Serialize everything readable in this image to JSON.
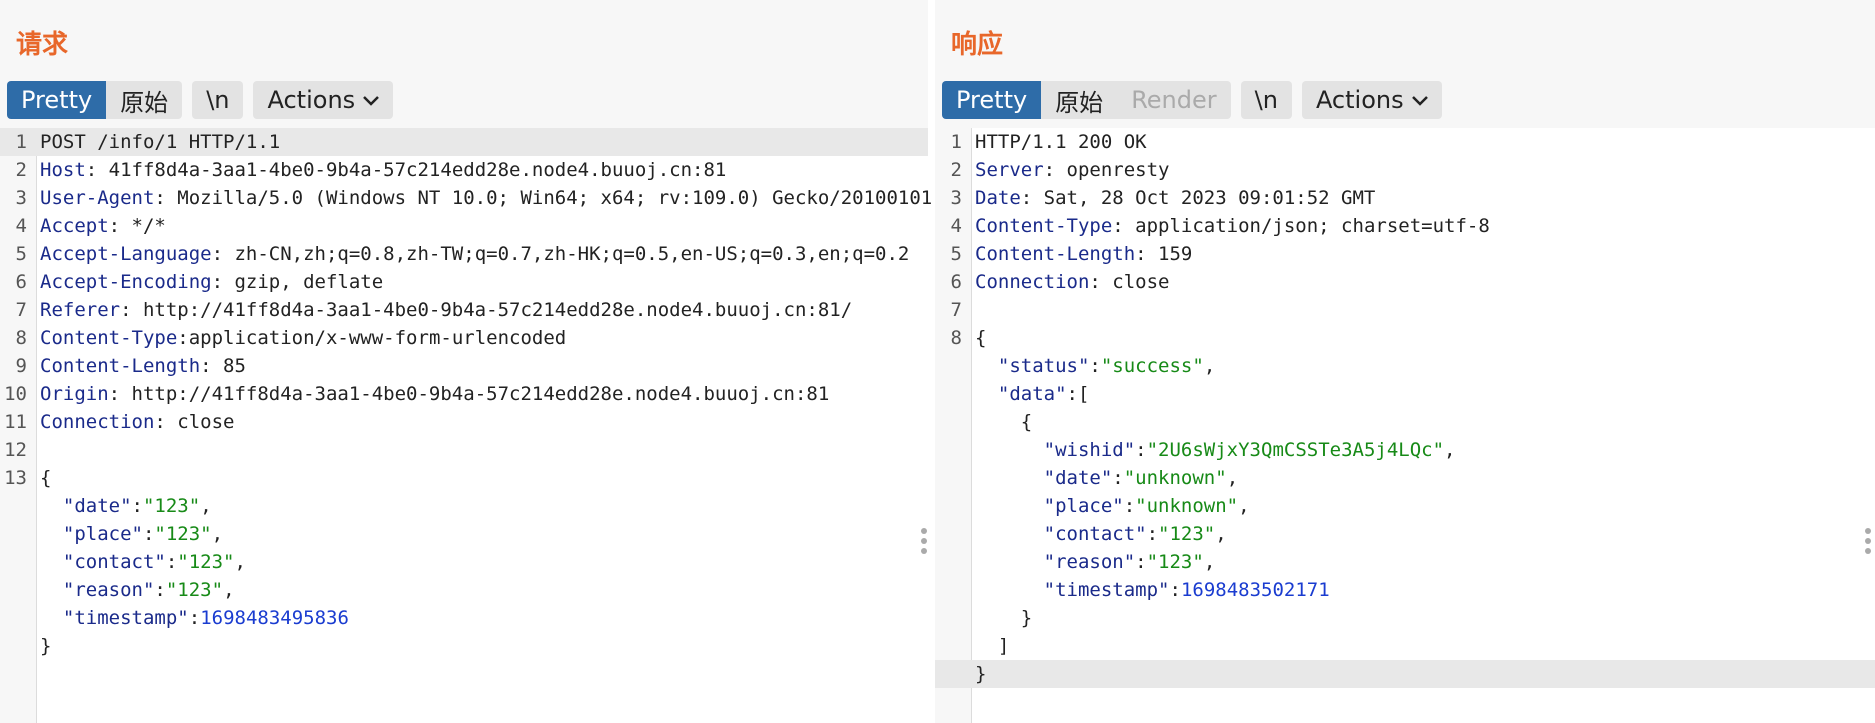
{
  "request": {
    "title": "请求",
    "toolbar": {
      "pretty": "Pretty",
      "raw": "原始",
      "newline": "\\n",
      "actions": "Actions"
    },
    "lines": [
      {
        "n": "1",
        "parts": [
          [
            "t",
            "POST /info/1 HTTP/1.1"
          ]
        ],
        "hl": true
      },
      {
        "n": "2",
        "parts": [
          [
            "k",
            "Host"
          ],
          [
            "t",
            ": 41ff8d4a-3aa1-4be0-9b4a-57c214edd28e.node4.buuoj.cn:81"
          ]
        ]
      },
      {
        "n": "3",
        "parts": [
          [
            "k",
            "User-Agent"
          ],
          [
            "t",
            ": Mozilla/5.0 (Windows NT 10.0; Win64; x64; rv:109.0) Gecko/20100101"
          ]
        ]
      },
      {
        "n": "4",
        "parts": [
          [
            "k",
            "Accept"
          ],
          [
            "t",
            ": */*"
          ]
        ]
      },
      {
        "n": "5",
        "parts": [
          [
            "k",
            "Accept-Language"
          ],
          [
            "t",
            ": zh-CN,zh;q=0.8,zh-TW;q=0.7,zh-HK;q=0.5,en-US;q=0.3,en;q=0.2"
          ]
        ]
      },
      {
        "n": "6",
        "parts": [
          [
            "k",
            "Accept-Encoding"
          ],
          [
            "t",
            ": gzip, deflate"
          ]
        ]
      },
      {
        "n": "7",
        "parts": [
          [
            "k",
            "Referer"
          ],
          [
            "t",
            ": http://41ff8d4a-3aa1-4be0-9b4a-57c214edd28e.node4.buuoj.cn:81/"
          ]
        ]
      },
      {
        "n": "8",
        "parts": [
          [
            "k",
            "Content-Type"
          ],
          [
            "t",
            ":application/x-www-form-urlencoded"
          ]
        ]
      },
      {
        "n": "9",
        "parts": [
          [
            "k",
            "Content-Length"
          ],
          [
            "t",
            ": 85"
          ]
        ]
      },
      {
        "n": "10",
        "parts": [
          [
            "k",
            "Origin"
          ],
          [
            "t",
            ": http://41ff8d4a-3aa1-4be0-9b4a-57c214edd28e.node4.buuoj.cn:81"
          ]
        ]
      },
      {
        "n": "11",
        "parts": [
          [
            "k",
            "Connection"
          ],
          [
            "t",
            ": close"
          ]
        ]
      },
      {
        "n": "12",
        "parts": []
      },
      {
        "n": "13",
        "parts": [
          [
            "t",
            "{"
          ]
        ]
      },
      {
        "n": "",
        "parts": [
          [
            "t",
            "  "
          ],
          [
            "k",
            "\"date\""
          ],
          [
            "t",
            ":"
          ],
          [
            "s",
            "\"123\""
          ],
          [
            "t",
            ","
          ]
        ]
      },
      {
        "n": "",
        "parts": [
          [
            "t",
            "  "
          ],
          [
            "k",
            "\"place\""
          ],
          [
            "t",
            ":"
          ],
          [
            "s",
            "\"123\""
          ],
          [
            "t",
            ","
          ]
        ]
      },
      {
        "n": "",
        "parts": [
          [
            "t",
            "  "
          ],
          [
            "k",
            "\"contact\""
          ],
          [
            "t",
            ":"
          ],
          [
            "s",
            "\"123\""
          ],
          [
            "t",
            ","
          ]
        ]
      },
      {
        "n": "",
        "parts": [
          [
            "t",
            "  "
          ],
          [
            "k",
            "\"reason\""
          ],
          [
            "t",
            ":"
          ],
          [
            "s",
            "\"123\""
          ],
          [
            "t",
            ","
          ]
        ]
      },
      {
        "n": "",
        "parts": [
          [
            "t",
            "  "
          ],
          [
            "k",
            "\"timestamp\""
          ],
          [
            "t",
            ":"
          ],
          [
            "n",
            "1698483495836"
          ]
        ]
      },
      {
        "n": "",
        "parts": [
          [
            "t",
            "}"
          ]
        ]
      }
    ]
  },
  "response": {
    "title": "响应",
    "toolbar": {
      "pretty": "Pretty",
      "raw": "原始",
      "render": "Render",
      "newline": "\\n",
      "actions": "Actions"
    },
    "lines": [
      {
        "n": "1",
        "parts": [
          [
            "t",
            "HTTP/1.1 200 OK"
          ]
        ]
      },
      {
        "n": "2",
        "parts": [
          [
            "k",
            "Server"
          ],
          [
            "t",
            ": openresty"
          ]
        ]
      },
      {
        "n": "3",
        "parts": [
          [
            "k",
            "Date"
          ],
          [
            "t",
            ": Sat, 28 Oct 2023 09:01:52 GMT"
          ]
        ]
      },
      {
        "n": "4",
        "parts": [
          [
            "k",
            "Content-Type"
          ],
          [
            "t",
            ": application/json; charset=utf-8"
          ]
        ]
      },
      {
        "n": "5",
        "parts": [
          [
            "k",
            "Content-Length"
          ],
          [
            "t",
            ": 159"
          ]
        ]
      },
      {
        "n": "6",
        "parts": [
          [
            "k",
            "Connection"
          ],
          [
            "t",
            ": close"
          ]
        ]
      },
      {
        "n": "7",
        "parts": []
      },
      {
        "n": "8",
        "parts": [
          [
            "t",
            "{"
          ]
        ]
      },
      {
        "n": "",
        "parts": [
          [
            "t",
            "  "
          ],
          [
            "k",
            "\"status\""
          ],
          [
            "t",
            ":"
          ],
          [
            "s",
            "\"success\""
          ],
          [
            "t",
            ","
          ]
        ]
      },
      {
        "n": "",
        "parts": [
          [
            "t",
            "  "
          ],
          [
            "k",
            "\"data\""
          ],
          [
            "t",
            ":["
          ]
        ]
      },
      {
        "n": "",
        "parts": [
          [
            "t",
            "    {"
          ]
        ]
      },
      {
        "n": "",
        "parts": [
          [
            "t",
            "      "
          ],
          [
            "k",
            "\"wishid\""
          ],
          [
            "t",
            ":"
          ],
          [
            "s",
            "\"2U6sWjxY3QmCSSTe3A5j4LQc\""
          ],
          [
            "t",
            ","
          ]
        ]
      },
      {
        "n": "",
        "parts": [
          [
            "t",
            "      "
          ],
          [
            "k",
            "\"date\""
          ],
          [
            "t",
            ":"
          ],
          [
            "s",
            "\"unknown\""
          ],
          [
            "t",
            ","
          ]
        ]
      },
      {
        "n": "",
        "parts": [
          [
            "t",
            "      "
          ],
          [
            "k",
            "\"place\""
          ],
          [
            "t",
            ":"
          ],
          [
            "s",
            "\"unknown\""
          ],
          [
            "t",
            ","
          ]
        ]
      },
      {
        "n": "",
        "parts": [
          [
            "t",
            "      "
          ],
          [
            "k",
            "\"contact\""
          ],
          [
            "t",
            ":"
          ],
          [
            "s",
            "\"123\""
          ],
          [
            "t",
            ","
          ]
        ]
      },
      {
        "n": "",
        "parts": [
          [
            "t",
            "      "
          ],
          [
            "k",
            "\"reason\""
          ],
          [
            "t",
            ":"
          ],
          [
            "s",
            "\"123\""
          ],
          [
            "t",
            ","
          ]
        ]
      },
      {
        "n": "",
        "parts": [
          [
            "t",
            "      "
          ],
          [
            "k",
            "\"timestamp\""
          ],
          [
            "t",
            ":"
          ],
          [
            "n",
            "1698483502171"
          ]
        ]
      },
      {
        "n": "",
        "parts": [
          [
            "t",
            "    }"
          ]
        ]
      },
      {
        "n": "",
        "parts": [
          [
            "t",
            "  ]"
          ]
        ]
      },
      {
        "n": "",
        "parts": [
          [
            "t",
            "}"
          ]
        ],
        "hl": true
      }
    ]
  },
  "colors": {
    "accent": "#2e6ca8",
    "title": "#e8672a",
    "key": "#1a2a8a",
    "string": "#178a17",
    "number": "#1a3cd0"
  }
}
